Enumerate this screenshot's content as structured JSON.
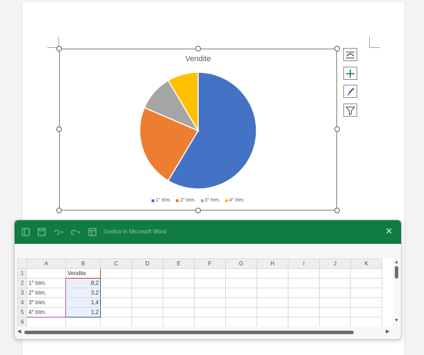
{
  "chart": {
    "title": "Vendite",
    "legend": [
      "1° trim.",
      "2° trim.",
      "3° trim.",
      "4° trim."
    ],
    "colors": [
      "#4472c4",
      "#ed7d31",
      "#a5a5a5",
      "#ffc000"
    ]
  },
  "chart_data": {
    "type": "pie",
    "title": "Vendite",
    "categories": [
      "1° trim.",
      "2° trim.",
      "3° trim.",
      "4° trim."
    ],
    "values": [
      8.2,
      3.2,
      1.4,
      1.2
    ],
    "legend_position": "bottom"
  },
  "side_buttons": [
    "layout-options-icon",
    "chart-elements-icon",
    "chart-styles-icon",
    "chart-filters-icon"
  ],
  "excel": {
    "title": "Grafico in Microsoft Word",
    "close": "✕",
    "columns": [
      "A",
      "B",
      "C",
      "D",
      "E",
      "F",
      "G",
      "H",
      "I",
      "J",
      "K"
    ],
    "rows": [
      {
        "num": "1",
        "a": "",
        "b": "Vendite"
      },
      {
        "num": "2",
        "a": "1° trim.",
        "b": "8,2"
      },
      {
        "num": "3",
        "a": "2° trim.",
        "b": "3,2"
      },
      {
        "num": "4",
        "a": "3° trim.",
        "b": "1,4"
      },
      {
        "num": "5",
        "a": "4° trim.",
        "b": "1,2"
      },
      {
        "num": "6",
        "a": "",
        "b": ""
      }
    ]
  }
}
